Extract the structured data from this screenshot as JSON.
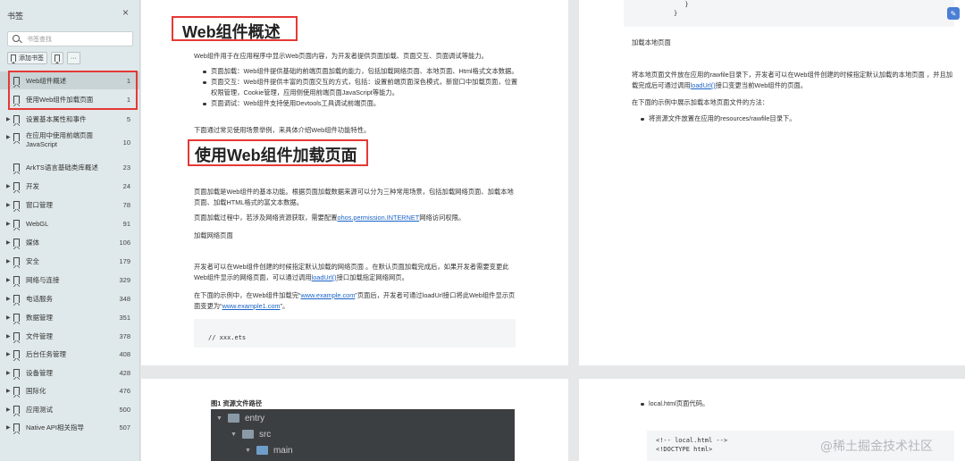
{
  "sidebar": {
    "title": "书签",
    "close_icon": "×",
    "search_placeholder": "书签查找",
    "add_bookmark": "添加书签",
    "more": "···",
    "items": [
      {
        "label": "Web组件概述",
        "count": "1",
        "expand": false,
        "selected": true
      },
      {
        "label": "使用Web组件加载页面",
        "count": "1",
        "expand": false,
        "selected": false
      },
      {
        "label": "设置基本属性和事件",
        "count": "5",
        "expand": true
      },
      {
        "label": "在应用中使用前端页面JavaScript",
        "count": "10",
        "expand": true
      },
      {
        "label": "ArkTS语言基础类库概述",
        "count": "23",
        "expand": false
      },
      {
        "label": "开发",
        "count": "24",
        "expand": true
      },
      {
        "label": "窗口管理",
        "count": "78",
        "expand": true
      },
      {
        "label": "WebGL",
        "count": "91",
        "expand": true
      },
      {
        "label": "媒体",
        "count": "106",
        "expand": true
      },
      {
        "label": "安全",
        "count": "179",
        "expand": true
      },
      {
        "label": "网络与连接",
        "count": "329",
        "expand": true
      },
      {
        "label": "电话服务",
        "count": "348",
        "expand": true
      },
      {
        "label": "数据管理",
        "count": "351",
        "expand": true
      },
      {
        "label": "文件管理",
        "count": "378",
        "expand": true
      },
      {
        "label": "后台任务管理",
        "count": "408",
        "expand": true
      },
      {
        "label": "设备管理",
        "count": "428",
        "expand": true
      },
      {
        "label": "国际化",
        "count": "476",
        "expand": true
      },
      {
        "label": "应用测试",
        "count": "500",
        "expand": true
      },
      {
        "label": "Native API相关指导",
        "count": "507",
        "expand": true
      }
    ]
  },
  "page1": {
    "h1": "Web组件概述",
    "intro": "Web组件用于在应用程序中显示Web页面内容，为开发者提供页面加载、页面交互、页面调试等能力。",
    "bullets": [
      "页面加载：Web组件提供基础的前端页面加载的能力，包括加载网络页面、本地页面、Html格式文本数据。",
      "页面交互：Web组件提供丰富的页面交互的方式，包括：设置前端页面深色模式，新窗口中加载页面，位置权限管理，Cookie管理，应用侧使用前端页面JavaScript等能力。",
      "页面调试：Web组件支持使用Devtools工具调试前端页面。"
    ],
    "outro": "下面通过常见使用场景举例，来具体介绍Web组件功能特性。",
    "h2": "使用Web组件加载页面",
    "p1": "页面加载是Web组件的基本功能。根据页面加载数据来源可以分为三种常用场景，包括加载网络页面、加载本地页面、加载HTML格式的富文本数据。",
    "p2_before": "页面加载过程中，若涉及网络资源获取，需要配置",
    "p2_link": "ohos.permission.INTERNET",
    "p2_after": "网络访问权限。",
    "sub": "加载网络页面",
    "p3_before": "开发者可以在Web组件创建的时候指定默认加载的网络页面 。在默认页面加载完成后，如果开发者需要变更此Web组件显示的网络页面，可以通过调用",
    "p3_link": "loadUrl()",
    "p3_after": "接口加载指定网络网页。",
    "p4_a": "在下面的示例中，在Web组件加载完“",
    "p4_link1": "www.example.com",
    "p4_b": "”页面后，开发者可通过loadUrl接口将此Web组件显示页面变更为“",
    "p4_link2": "www.example1.com",
    "p4_c": "”。",
    "code": "// xxx.ets"
  },
  "page2": {
    "code_lines": [
      "  }",
      "}"
    ],
    "sub": "加载本地页面",
    "p1_before": "将本地页面文件放在应用的rawfile目录下，开发者可以在Web组件创建的时候指定默认加载的本地页面 ，并且加载完成后可通过调用",
    "p1_link": "loadUrl()",
    "p1_after": "接口变更当前Web组件的页面。",
    "p2": "在下面的示例中展示加载本地页面文件的方法：",
    "bullet": "将资源文件放置在应用的resources/rawfile目录下。"
  },
  "page3": {
    "caption": "图1 资源文件路径",
    "tree": [
      "entry",
      "src",
      "main"
    ]
  },
  "page4": {
    "bullet": "local.html页面代码。",
    "code_lines": [
      "<!-- local.html -->",
      "<!DOCTYPE html>"
    ]
  },
  "watermark": "@稀土掘金技术社区",
  "edit_icon": "✎"
}
